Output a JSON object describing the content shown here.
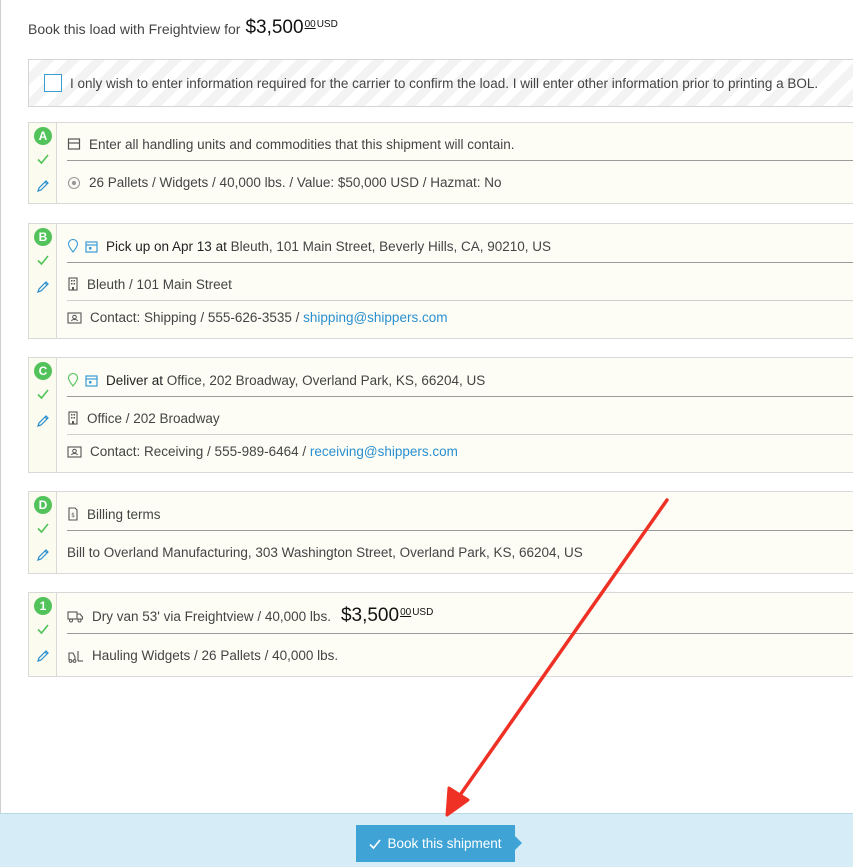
{
  "header": {
    "label": "Book this load with Freightview for",
    "price_main": "$3,500",
    "price_cents": "00",
    "currency": "USD"
  },
  "confirm": {
    "text": "I only wish to enter information required for the carrier to confirm the load. I will enter other information prior to printing a BOL.",
    "checked": false
  },
  "sections": {
    "a": {
      "badge": "A",
      "line1": "Enter all handling units and commodities that this shipment will contain.",
      "line2": "26 Pallets / Widgets / 40,000 lbs. / Value: $50,000 USD / Hazmat: No"
    },
    "b": {
      "badge": "B",
      "strong": "Pick up on Apr 13 at",
      "loc": "Bleuth, 101 Main Street, Beverly Hills, CA, 90210, US",
      "line2": "Bleuth / 101 Main Street",
      "contact": "Contact: Shipping / 555-626-3535 /",
      "email": "shipping@shippers.com"
    },
    "c": {
      "badge": "C",
      "strong": "Deliver at",
      "loc": "Office, 202 Broadway, Overland Park, KS, 66204, US",
      "line2": "Office / 202 Broadway",
      "contact": "Contact: Receiving / 555-989-6464 /",
      "email": "receiving@shippers.com"
    },
    "d": {
      "badge": "D",
      "line1": "Billing terms",
      "line2": "Bill to Overland Manufacturing, 303 Washington Street, Overland Park, KS, 66204, US"
    },
    "e": {
      "badge": "1",
      "line1": "Dry van 53' via Freightview / 40,000 lbs.",
      "price_main": "$3,500",
      "price_cents": "00",
      "currency": "USD",
      "line2": "Hauling Widgets / 26 Pallets / 40,000 lbs."
    }
  },
  "footer": {
    "book_label": "Book this shipment"
  },
  "colors": {
    "accent": "#3fa3d6",
    "success": "#52c35a",
    "annotation": "#ee3124",
    "link": "#2a8fcf"
  }
}
